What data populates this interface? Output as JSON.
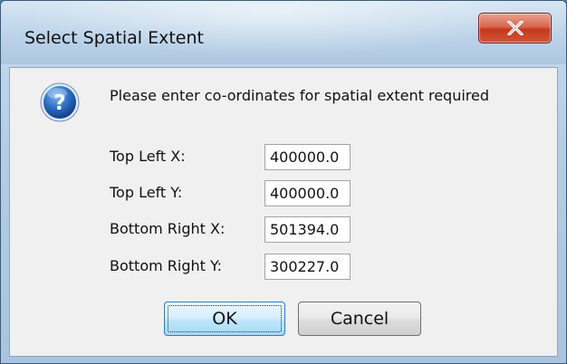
{
  "dialog": {
    "title": "Select Spatial Extent",
    "close_icon": "close-icon",
    "question_icon": "question-icon",
    "message": "Please enter co-ordinates for spatial extent required"
  },
  "fields": [
    {
      "label": "Top Left X:",
      "value": "400000.0"
    },
    {
      "label": "Top Left Y:",
      "value": "400000.0"
    },
    {
      "label": "Bottom Right X:",
      "value": "501394.0"
    },
    {
      "label": "Bottom Right Y:",
      "value": "300227.0"
    }
  ],
  "buttons": {
    "ok_label": "OK",
    "cancel_label": "Cancel"
  },
  "colors": {
    "close_button": "#c4381c",
    "question_icon": "#1f5fb0",
    "ok_button_border": "#2d7ec4"
  }
}
